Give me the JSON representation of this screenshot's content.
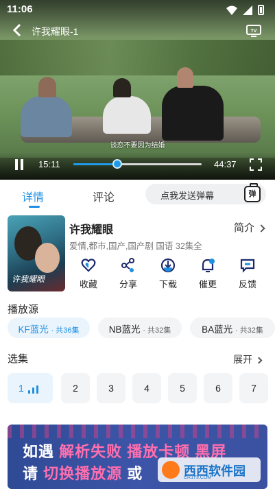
{
  "status_bar": {
    "time": "11:06"
  },
  "player": {
    "title": "许我耀眼-1",
    "subtitle": "谈恋不要因为结婚",
    "current_time": "15:11",
    "duration": "44:37",
    "progress_percent": 34
  },
  "tabs": {
    "details": "详情",
    "comments": "评论"
  },
  "danmu": {
    "placeholder": "点我发送弹幕",
    "icon_text": "弹"
  },
  "show": {
    "poster_title": "许我耀眼",
    "title": "许我耀眼",
    "intro_label": "简介",
    "meta": "爱情,都市,国产,国产剧 国语 32集全"
  },
  "actions": [
    {
      "label": "收藏",
      "icon": "heart-icon"
    },
    {
      "label": "分享",
      "icon": "share-icon"
    },
    {
      "label": "下载",
      "icon": "download-icon"
    },
    {
      "label": "催更",
      "icon": "remind-icon"
    },
    {
      "label": "反馈",
      "icon": "feedback-icon"
    }
  ],
  "sources": {
    "title": "播放源",
    "items": [
      {
        "name": "KF蓝光",
        "count": "· 共36集",
        "active": true
      },
      {
        "name": "NB蓝光",
        "count": "· 共32集",
        "active": false
      },
      {
        "name": "BA蓝光",
        "count": "· 共32集",
        "active": false
      }
    ]
  },
  "episodes": {
    "title": "选集",
    "expand_label": "展开",
    "items": [
      "1",
      "2",
      "3",
      "4",
      "5",
      "6",
      "7"
    ]
  },
  "banner": {
    "line1_a": "如遇",
    "line1_b": "解析失败 播放卡顿 黑屏",
    "line2_a": "请",
    "line2_b": "切换播放源",
    "line2_c": "或",
    "watermark": "西西软件园",
    "watermark_url": "CR173.COM"
  },
  "colors": {
    "accent": "#1e8fe3",
    "banner_bg": "#3a52a0",
    "banner_highlight": "#ff6fae"
  }
}
